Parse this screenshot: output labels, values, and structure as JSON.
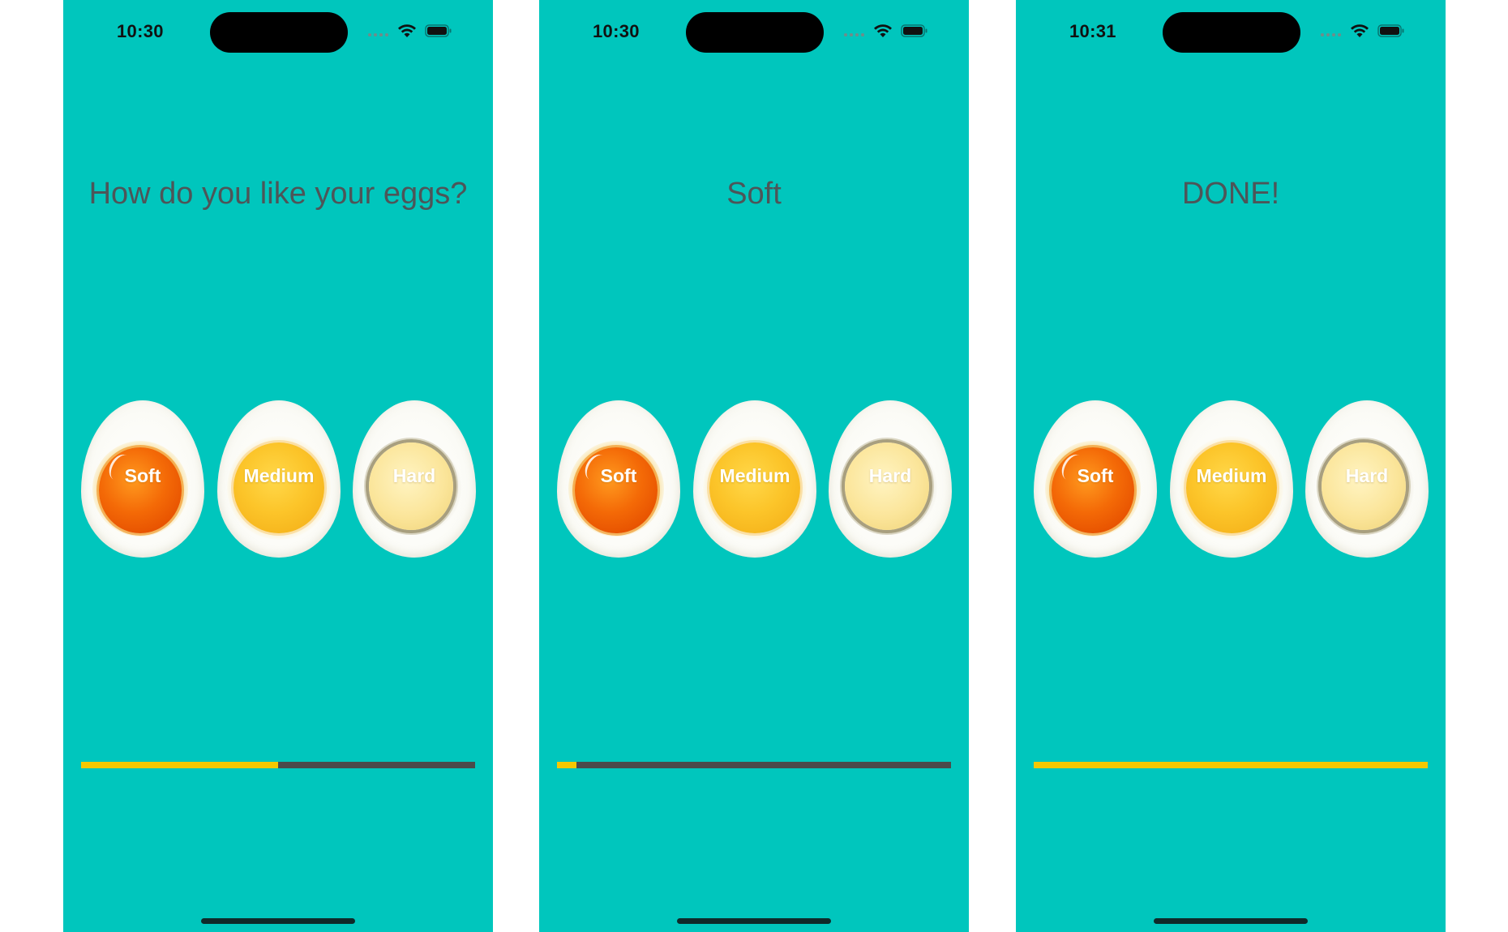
{
  "screens": [
    {
      "status_time": "10:30",
      "title": "How do you like your eggs?",
      "progress": 0.5,
      "eggs": [
        {
          "label": "Soft",
          "icon": "soft-boiled-egg-icon"
        },
        {
          "label": "Medium",
          "icon": "medium-boiled-egg-icon"
        },
        {
          "label": "Hard",
          "icon": "hard-boiled-egg-icon"
        }
      ]
    },
    {
      "status_time": "10:30",
      "title": "Soft",
      "progress": 0.05,
      "eggs": [
        {
          "label": "Soft",
          "icon": "soft-boiled-egg-icon"
        },
        {
          "label": "Medium",
          "icon": "medium-boiled-egg-icon"
        },
        {
          "label": "Hard",
          "icon": "hard-boiled-egg-icon"
        }
      ]
    },
    {
      "status_time": "10:31",
      "title": "DONE!",
      "progress": 1.0,
      "eggs": [
        {
          "label": "Soft",
          "icon": "soft-boiled-egg-icon"
        },
        {
          "label": "Medium",
          "icon": "medium-boiled-egg-icon"
        },
        {
          "label": "Hard",
          "icon": "hard-boiled-egg-icon"
        }
      ]
    }
  ],
  "colors": {
    "background": "#00c6bd",
    "title_text": "#4d5558",
    "progress_fill": "#f5c800",
    "progress_track": "#4b4b4b",
    "island": "#000000"
  }
}
